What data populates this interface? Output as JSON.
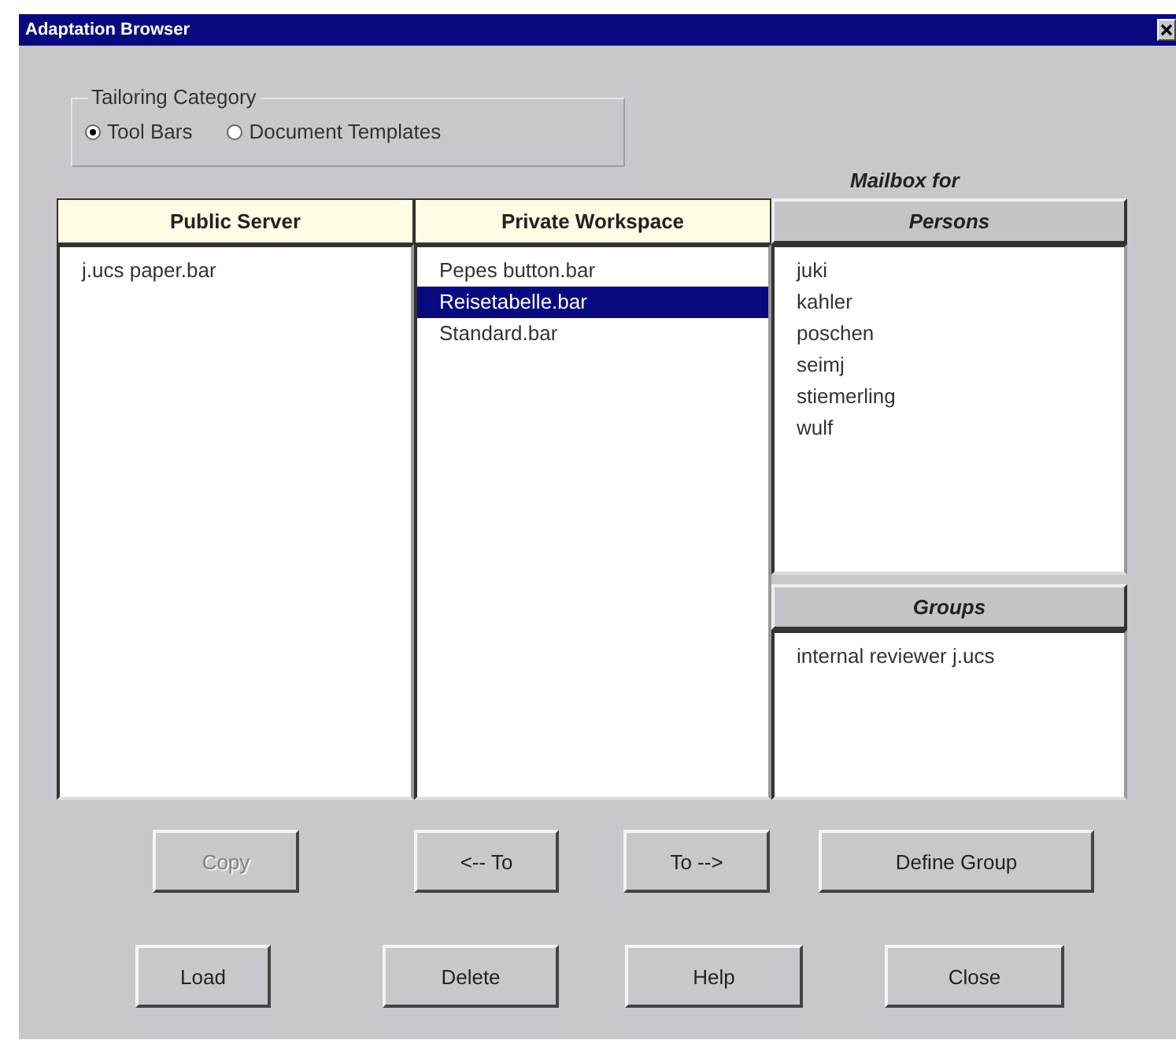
{
  "window": {
    "title": "Adaptation Browser"
  },
  "tailoring_category": {
    "label": "Tailoring Category",
    "options": [
      {
        "label": "Tool Bars",
        "selected": true
      },
      {
        "label": "Document Templates",
        "selected": false
      }
    ]
  },
  "mailbox_label": "Mailbox for",
  "panels": [
    {
      "kind": "store",
      "header": "Public Server",
      "items": [
        {
          "label": "j.ucs paper.bar",
          "selected": false
        }
      ]
    },
    {
      "kind": "store",
      "header": "Private Workspace",
      "items": [
        {
          "label": "Pepes button.bar",
          "selected": false
        },
        {
          "label": "Reisetabelle.bar",
          "selected": true
        },
        {
          "label": "Standard.bar",
          "selected": false
        }
      ]
    }
  ],
  "persons": {
    "header": "Persons",
    "items": [
      {
        "label": "juki",
        "selected": false
      },
      {
        "label": "kahler",
        "selected": false
      },
      {
        "label": "poschen",
        "selected": false
      },
      {
        "label": "seimj",
        "selected": false
      },
      {
        "label": "stiemerling",
        "selected": false
      },
      {
        "label": "wulf",
        "selected": false
      }
    ]
  },
  "groups": {
    "header": "Groups",
    "items": [
      {
        "label": "internal reviewer j.ucs",
        "selected": false
      }
    ]
  },
  "button_rows": [
    [
      {
        "label": "Copy",
        "disabled": true
      },
      {
        "label": "<-- To",
        "disabled": false
      },
      {
        "label": "To -->",
        "disabled": false
      },
      {
        "label": "Define Group",
        "disabled": false
      }
    ],
    [
      {
        "label": "Load",
        "disabled": false
      },
      {
        "label": "Delete",
        "disabled": false
      },
      {
        "label": "Help",
        "disabled": false
      },
      {
        "label": "Close",
        "disabled": false
      }
    ]
  ]
}
